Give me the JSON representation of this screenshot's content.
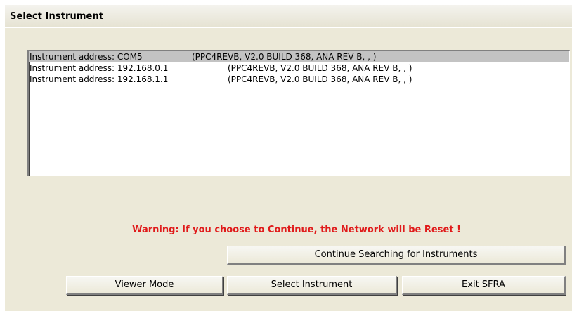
{
  "window": {
    "title": "Select Instrument"
  },
  "instrument_list": {
    "rows": [
      {
        "address": "Instrument address: COM5",
        "info": "(PPC4REVB, V2.0 BUILD 368, ANA REV B, , )",
        "selected": true
      },
      {
        "address": "Instrument address: 192.168.0.1",
        "info": "(PPC4REVB, V2.0 BUILD 368, ANA REV B, , )",
        "selected": false
      },
      {
        "address": "Instrument address: 192.168.1.1",
        "info": "(PPC4REVB, V2.0 BUILD 368, ANA REV B, , )",
        "selected": false
      }
    ]
  },
  "warning": {
    "text": "Warning: If you choose to Continue, the Network will be Reset !",
    "color": "#e01a1a"
  },
  "buttons": {
    "continue_searching": "Continue Searching for Instruments",
    "viewer_mode": "Viewer Mode",
    "select_instrument": "Select Instrument",
    "exit": "Exit SFRA"
  }
}
